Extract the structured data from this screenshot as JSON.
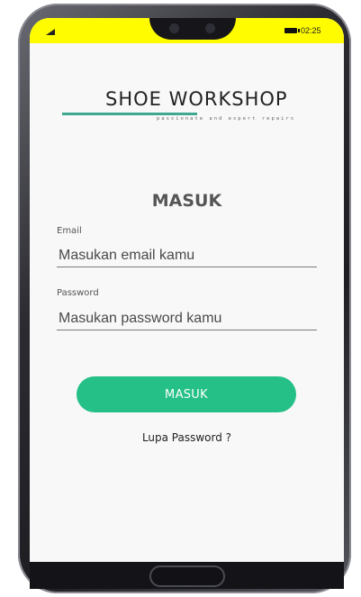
{
  "status_bar": {
    "time": "02:25",
    "signal_icon": "signal-icon",
    "battery_icon": "battery-icon",
    "bar_color": "#fffc00"
  },
  "logo": {
    "name": "SHOE  WORKSHOP",
    "tagline": "passionate and expert repairs",
    "accent_color": "#3ea98f"
  },
  "login": {
    "title": "MASUK",
    "email_label": "Email",
    "email_placeholder": "Masukan email kamu",
    "password_label": "Password",
    "password_placeholder": "Masukan password kamu",
    "submit_label": "MASUK",
    "forgot_label": "Lupa Password ?",
    "button_color": "#25c088"
  }
}
